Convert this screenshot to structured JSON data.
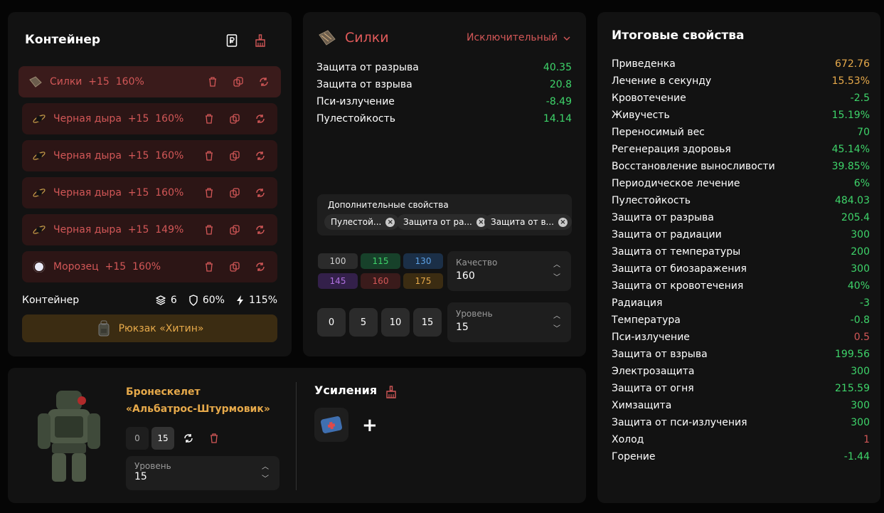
{
  "colors": {
    "green": "#3ed46a",
    "red": "#d25757",
    "orange": "#e6a94a",
    "panel": "#121212"
  },
  "container": {
    "title": "Контейнер",
    "header_icons": [
      "ruble-doc-icon",
      "broom-icon"
    ],
    "artifacts": [
      {
        "name": "Силки",
        "level": "+15",
        "quality": "160%",
        "icon": "silki-icon"
      },
      {
        "name": "Черная дыра",
        "level": "+15",
        "quality": "160%",
        "icon": "black-hole-icon"
      },
      {
        "name": "Черная дыра",
        "level": "+15",
        "quality": "160%",
        "icon": "black-hole-icon"
      },
      {
        "name": "Черная дыра",
        "level": "+15",
        "quality": "160%",
        "icon": "black-hole-icon"
      },
      {
        "name": "Черная дыра",
        "level": "+15",
        "quality": "149%",
        "icon": "black-hole-icon"
      },
      {
        "name": "Морозец",
        "level": "+15",
        "quality": "160%",
        "icon": "morozets-icon"
      }
    ],
    "footer_label": "Контейнер",
    "slots": "6",
    "protection": "60%",
    "efficiency": "115%",
    "backpack": "Рюкзак «Хитин»"
  },
  "artifact": {
    "name": "Силки",
    "rarity": "Исключительный",
    "props": [
      {
        "label": "Защита от разрыва",
        "value": "40.35"
      },
      {
        "label": "Защита от взрыва",
        "value": "20.8"
      },
      {
        "label": "Пси-излучение",
        "value": "-8.49"
      },
      {
        "label": "Пулестойкость",
        "value": "14.14"
      }
    ],
    "extra_title": "Дополнительные свойства",
    "chips": [
      "Пулестой...",
      "Защита от ра...",
      "Защита от в..."
    ],
    "quality_buttons": [
      {
        "label": "100",
        "bg": "#2b2b2b",
        "fg": "#cfcfcf"
      },
      {
        "label": "115",
        "bg": "#17412a",
        "fg": "#3ed46a"
      },
      {
        "label": "130",
        "bg": "#1b2f47",
        "fg": "#5da2e6"
      },
      {
        "label": "145",
        "bg": "#33204a",
        "fg": "#b071e0"
      },
      {
        "label": "160",
        "bg": "#3a1b1b",
        "fg": "#d25757"
      },
      {
        "label": "175",
        "bg": "#3b2c12",
        "fg": "#e6a94a"
      }
    ],
    "quality_label": "Качество",
    "quality_value": "160",
    "level_buttons": [
      "0",
      "5",
      "10",
      "15"
    ],
    "level_label": "Уровень",
    "level_value": "15"
  },
  "totals": {
    "title": "Итоговые свойства",
    "rows": [
      {
        "label": "Приведенка",
        "value": "672.76",
        "color": "#e6a94a"
      },
      {
        "label": "Лечение в секунду",
        "value": "15.53%",
        "color": "#e6a94a"
      },
      {
        "label": "Кровотечение",
        "value": "-2.5",
        "color": "#3ed46a"
      },
      {
        "label": "Живучесть",
        "value": "15.19%",
        "color": "#3ed46a"
      },
      {
        "label": "Переносимый вес",
        "value": "70",
        "color": "#3ed46a"
      },
      {
        "label": "Регенерация здоровья",
        "value": "45.14%",
        "color": "#3ed46a"
      },
      {
        "label": "Восстановление выносливости",
        "value": "39.85%",
        "color": "#3ed46a"
      },
      {
        "label": "Периодическое лечение",
        "value": "6%",
        "color": "#3ed46a"
      },
      {
        "label": "Пулестойкость",
        "value": "484.03",
        "color": "#3ed46a"
      },
      {
        "label": "Защита от разрыва",
        "value": "205.4",
        "color": "#3ed46a"
      },
      {
        "label": "Защита от радиации",
        "value": "300",
        "color": "#3ed46a"
      },
      {
        "label": "Защита от температуры",
        "value": "200",
        "color": "#3ed46a"
      },
      {
        "label": "Защита от биозаражения",
        "value": "300",
        "color": "#3ed46a"
      },
      {
        "label": "Защита от кровотечения",
        "value": "40%",
        "color": "#3ed46a"
      },
      {
        "label": "Радиация",
        "value": "-3",
        "color": "#3ed46a"
      },
      {
        "label": "Температура",
        "value": "-0.8",
        "color": "#3ed46a"
      },
      {
        "label": "Пси-излучение",
        "value": "0.5",
        "color": "#d25757"
      },
      {
        "label": "Защита от взрыва",
        "value": "199.56",
        "color": "#3ed46a"
      },
      {
        "label": "Электрозащита",
        "value": "300",
        "color": "#3ed46a"
      },
      {
        "label": "Защита от огня",
        "value": "215.59",
        "color": "#3ed46a"
      },
      {
        "label": "Химзащита",
        "value": "300",
        "color": "#3ed46a"
      },
      {
        "label": "Защита от пси-излучения",
        "value": "300",
        "color": "#3ed46a"
      },
      {
        "label": "Холод",
        "value": "1",
        "color": "#d25757"
      },
      {
        "label": "Горение",
        "value": "-1.44",
        "color": "#3ed46a"
      }
    ]
  },
  "armor": {
    "name_line1": "Бронескелет",
    "name_line2": "«Альбатрос-Штурмовик»",
    "level_min": "0",
    "level_max": "15",
    "level_label": "Уровень",
    "level_value": "15",
    "boosts_title": "Усиления",
    "add_label": "+"
  }
}
